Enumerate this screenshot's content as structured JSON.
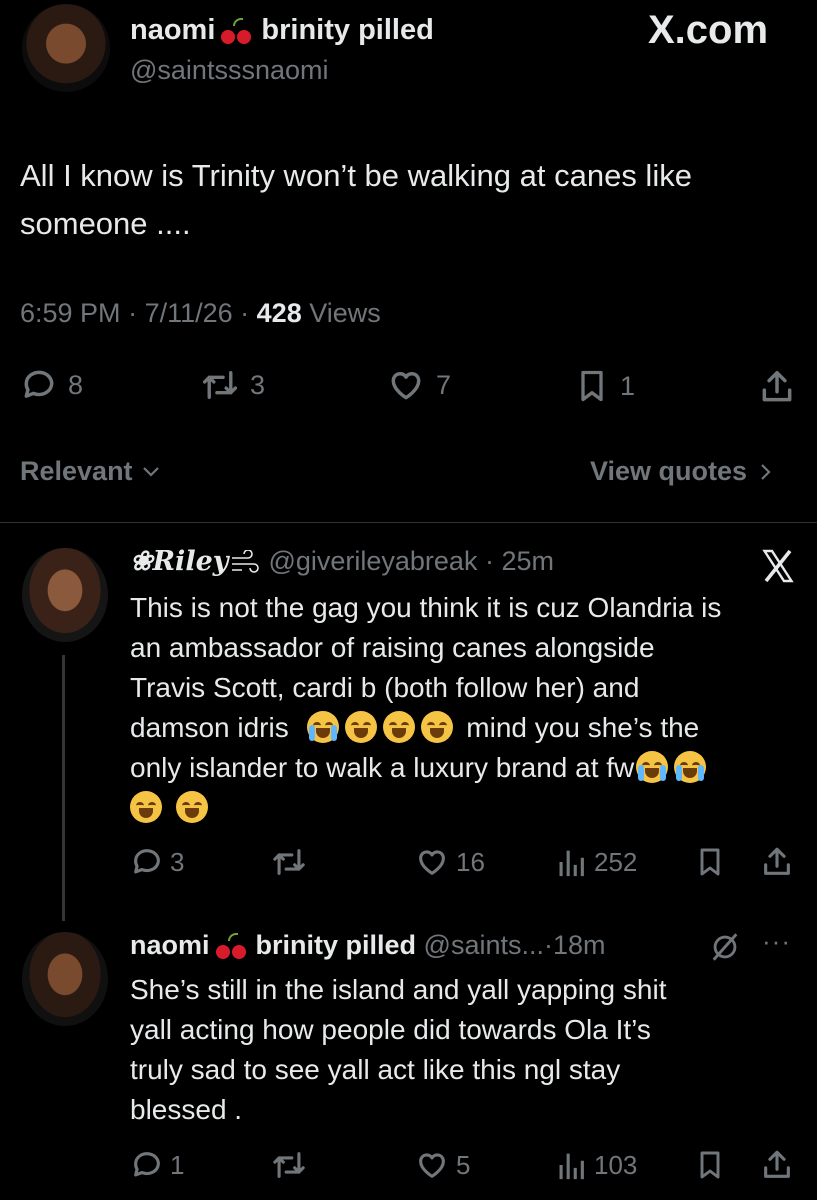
{
  "main_tweet": {
    "name": "naomi",
    "name_suffix": "brinity pilled",
    "handle": "@saintsssnaomi",
    "watermark": "X.com",
    "text_line1": "All I know is Trinity won’t be walking at canes like",
    "text_line2": "someone ....",
    "time": "6:59 PM",
    "date": "7/11/26",
    "views_count": "428",
    "views_label": "Views",
    "replies": "8",
    "reposts": "3",
    "likes": "7",
    "bookmarks": "1"
  },
  "sort_bar": {
    "relevant_label": "Relevant",
    "view_quotes_label": "View quotes"
  },
  "reply1": {
    "name": "❀Riley",
    "handle": "@giverileyabreak",
    "time": "25m",
    "text": [
      "This is not the gag you think it is cuz Olandria is",
      "an ambassador of raising canes alongside",
      "Travis Scott, cardi b (both follow her) and",
      "damson idris",
      "mind you she’s the",
      "only islander to walk a luxury brand at fw"
    ],
    "replies": "3",
    "reposts": "",
    "likes": "16",
    "views": "252"
  },
  "reply2": {
    "name": "naomi",
    "name_suffix": "brinity pilled",
    "handle": "@saints...",
    "time": "18m",
    "more": "···",
    "text": [
      "She’s still in the island and yall yapping shit",
      "yall acting how people did towards Ola It’s",
      "truly sad to see yall act like this ngl stay",
      "blessed ."
    ],
    "replies": "1",
    "reposts": "",
    "likes": "5",
    "views": "103"
  },
  "icons": [
    "reply-icon",
    "repost-icon",
    "like-icon",
    "bookmark-icon",
    "share-icon",
    "views-icon",
    "x-logo-icon",
    "grok-icon",
    "cherry-emoji",
    "crying-emoji",
    "laughing-cat-emoji"
  ],
  "colors": {
    "background": "#000000",
    "text": "#e7e9ea",
    "secondary": "#71767b",
    "divider": "#2f3336"
  }
}
